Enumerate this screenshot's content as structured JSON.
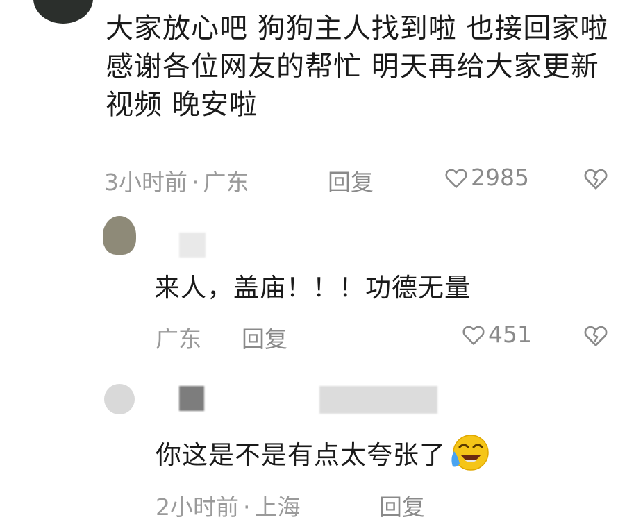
{
  "comments": [
    {
      "text": "大家放心吧 狗狗主人找到啦 也接回家啦 感谢各位网友的帮忙 明天再给大家更新视频 晚安啦",
      "time": "3小时前",
      "location": "广东",
      "reply_label": "回复",
      "likes": "2985",
      "replies": [
        {
          "text": "来人，盖庙！！！功德无量",
          "location": "广东",
          "reply_label": "回复",
          "likes": "451"
        },
        {
          "text": "你这是不是有点太夸张了",
          "time": "2小时前",
          "location": "上海",
          "reply_label": "回复"
        }
      ]
    }
  ],
  "icons": {
    "like": "heart-outline-icon",
    "dislike": "broken-heart-icon",
    "emoji": "laughing-crying-emoji"
  }
}
